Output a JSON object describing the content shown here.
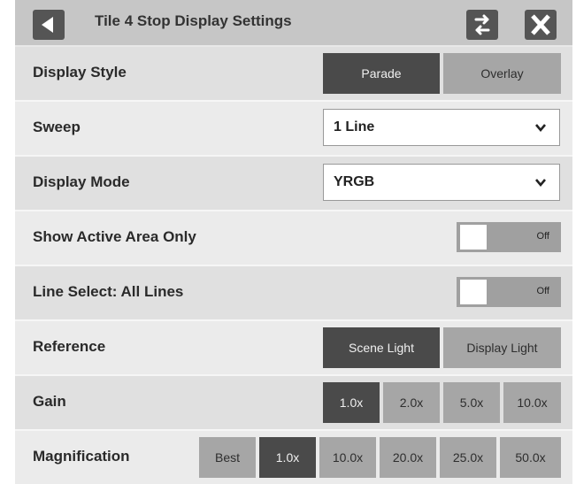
{
  "header": {
    "title": "Tile 4 Stop Display Settings",
    "back_icon": "back-triangle-icon",
    "swap_icon": "swap-arrows-icon",
    "close_icon": "close-x-icon"
  },
  "display_style": {
    "label": "Display Style",
    "options": [
      "Parade",
      "Overlay"
    ],
    "selected": "Parade"
  },
  "sweep": {
    "label": "Sweep",
    "value": "1 Line"
  },
  "display_mode": {
    "label": "Display Mode",
    "value": "YRGB"
  },
  "show_active_area": {
    "label": "Show Active Area Only",
    "state": "Off"
  },
  "line_select": {
    "label": "Line Select: All Lines",
    "state": "Off"
  },
  "reference": {
    "label": "Reference",
    "options": [
      "Scene Light",
      "Display Light"
    ],
    "selected": "Scene Light"
  },
  "gain": {
    "label": "Gain",
    "options": [
      "1.0x",
      "2.0x",
      "5.0x",
      "10.0x"
    ],
    "selected": "1.0x"
  },
  "magnification": {
    "label": "Magnification",
    "options": [
      "Best",
      "1.0x",
      "10.0x",
      "20.0x",
      "25.0x",
      "50.0x"
    ],
    "selected": "1.0x"
  },
  "colors": {
    "selected": "#4a4a4a",
    "unselected": "#a6a6a6",
    "header": "#c6c6c6"
  }
}
